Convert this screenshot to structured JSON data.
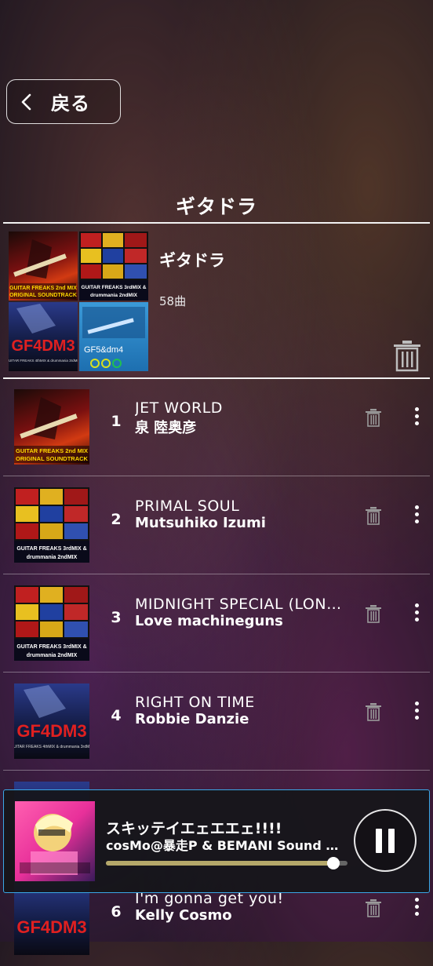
{
  "header": {
    "back_label": "戻る",
    "page_title": "ギタドラ"
  },
  "playlist": {
    "name": "ギタドラ",
    "count": "58曲",
    "covers": [
      {
        "text": "GUITAR FREAKS 2nd MIX ORIGINAL SOUNDTRACK"
      },
      {
        "text": "GUITAR FREAKS 3rdMIX & drummania 2ndMIX"
      },
      {
        "text": "GF4DM3"
      },
      {
        "text": "GF5&dm4"
      }
    ]
  },
  "tracks": [
    {
      "number": "1",
      "title": "JET WORLD",
      "artist": "泉 陸奥彦",
      "cover_text": "GUITAR FREAKS 2nd MIX ORIGINAL SOUNDTRACK"
    },
    {
      "number": "2",
      "title": "PRIMAL SOUL",
      "artist": "Mutsuhiko Izumi",
      "cover_text": "GUITAR FREAKS 3rdMIX & drummania 2ndMIX"
    },
    {
      "number": "3",
      "title": "MIDNIGHT SPECIAL (LON…",
      "artist": "Love machineguns",
      "cover_text": "GUITAR FREAKS 3rdMIX & drummania 2ndMIX"
    },
    {
      "number": "4",
      "title": "RIGHT ON TIME",
      "artist": "Robbie Danzie",
      "cover_text": "GF4DM3"
    },
    {
      "number": "6",
      "title": "I'm gonna get you!",
      "artist": "Kelly Cosmo",
      "cover_text": "GF4DM3"
    }
  ],
  "now_playing": {
    "title": "スキッテイエェエエェ!!!!",
    "artist": "cosMo@暴走P & BEMANI Sound …",
    "progress": 0.94
  },
  "colors": {
    "accent_border": "#3aa7e6",
    "progress_fill": "#b5a86a"
  }
}
